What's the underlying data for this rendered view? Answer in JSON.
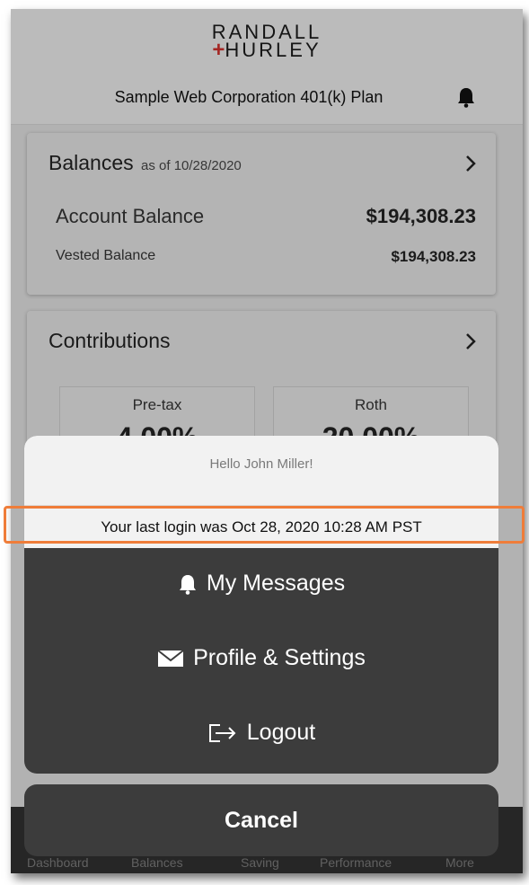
{
  "header": {
    "logo_line1": "RANDALL",
    "logo_line2": "HURLEY",
    "plan_title": "Sample Web Corporation 401(k) Plan"
  },
  "balances": {
    "title": "Balances",
    "as_of": "as of 10/28/2020",
    "account_label": "Account Balance",
    "account_value": "$194,308.23",
    "vested_label": "Vested Balance",
    "vested_value": "$194,308.23"
  },
  "contributions": {
    "title": "Contributions",
    "pretax_label": "Pre-tax",
    "pretax_value": "4.00%",
    "roth_label": "Roth",
    "roth_value": "20.00%"
  },
  "tabs": [
    "Dashboard",
    "Balances",
    "Saving",
    "Performance",
    "More"
  ],
  "sheet": {
    "greeting": "Hello John Miller!",
    "last_login": "Your last login was Oct 28, 2020 10:28 AM PST",
    "messages": "My Messages",
    "profile": "Profile & Settings",
    "logout": "Logout",
    "cancel": "Cancel"
  },
  "colors": {
    "highlight": "#ef7d3a",
    "sheet_bg": "#3c3c3c",
    "logo_accent": "#c9302c"
  }
}
